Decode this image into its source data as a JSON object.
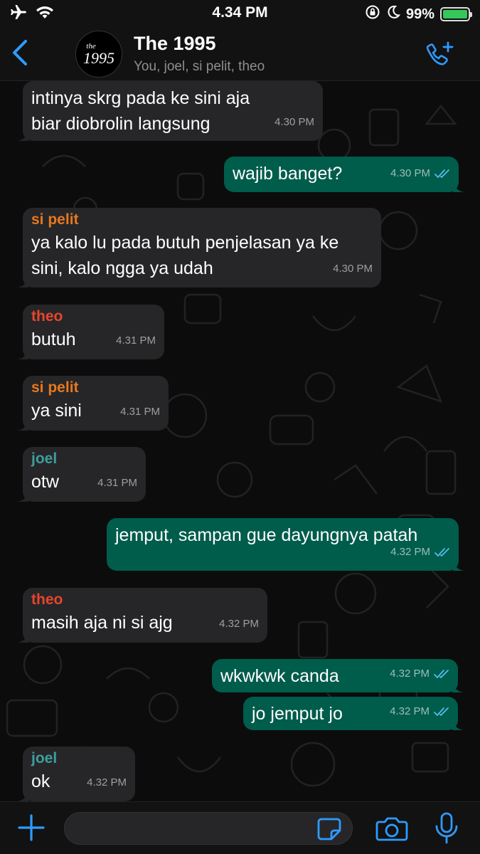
{
  "status_bar": {
    "time": "4.34 PM",
    "battery": "99%",
    "battery_level": 0.99,
    "icons": [
      "airplane-icon",
      "wifi-icon",
      "rotation-lock-icon",
      "moon-icon",
      "battery-charging-icon"
    ]
  },
  "header": {
    "group_name": "The 1995",
    "members": "You, joel, si pelit, theo",
    "avatar_small": "the",
    "avatar_big": "1995"
  },
  "colors": {
    "accent": "#2f9bff",
    "outgoing_bubble": "#005c4b",
    "incoming_bubble": "#262628",
    "read_ticks": "#53bdeb",
    "sender_si_pelit": "#e8781e",
    "sender_theo": "#e8452c",
    "sender_joel": "#3d9f9c"
  },
  "messages": [
    {
      "dir": "in",
      "sender": "",
      "text": "intinya skrg pada ke sini aja biar diobrolin langsung",
      "time": "4.30 PM"
    },
    {
      "dir": "out",
      "text": "wajib banget?",
      "time": "4.30 PM",
      "read": true
    },
    {
      "dir": "in",
      "sender": "si pelit",
      "text": "ya kalo lu pada butuh penjelasan ya ke sini, kalo ngga ya udah",
      "time": "4.30 PM"
    },
    {
      "dir": "in",
      "sender": "theo",
      "text": "butuh",
      "time": "4.31 PM"
    },
    {
      "dir": "in",
      "sender": "si pelit",
      "text": "ya sini",
      "time": "4.31 PM"
    },
    {
      "dir": "in",
      "sender": "joel",
      "text": "otw",
      "time": "4.31 PM"
    },
    {
      "dir": "out",
      "text": "jemput, sampan gue dayungnya patah",
      "time": "4.32 PM",
      "read": true
    },
    {
      "dir": "in",
      "sender": "theo",
      "text": "masih aja ni si ajg",
      "time": "4.32 PM"
    },
    {
      "dir": "out",
      "text": "wkwkwk canda",
      "time": "4.32 PM",
      "read": true
    },
    {
      "dir": "out",
      "text": "jo jemput jo",
      "time": "4.32 PM",
      "read": true
    },
    {
      "dir": "in",
      "sender": "joel",
      "text": "ok",
      "time": "4.32 PM"
    }
  ],
  "input": {
    "placeholder": "",
    "value": ""
  }
}
